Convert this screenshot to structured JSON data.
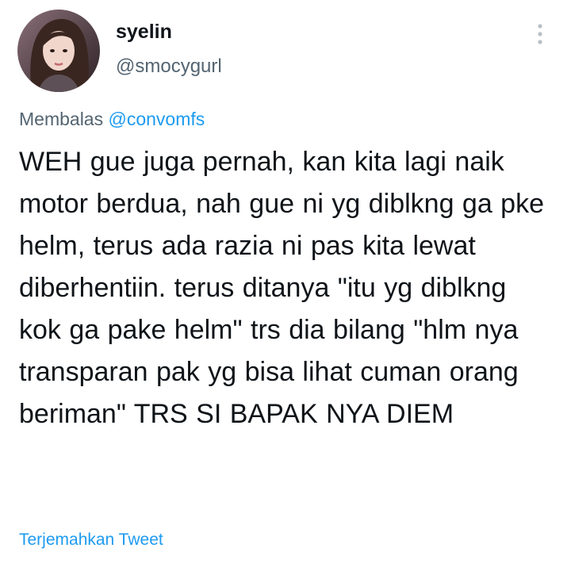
{
  "author": {
    "name": "syelin",
    "handle": "@smocygurl"
  },
  "reply_context": {
    "prefix": "Membalas",
    "mention": "@convomfs"
  },
  "tweet": {
    "text": "WEH gue juga pernah, kan kita lagi naik motor berdua, nah gue ni yg diblkng ga pke helm, terus ada razia ni pas kita lewat diberhentiin. terus ditanya \"itu yg diblkng kok ga pake helm\" trs dia bilang \"hlm nya transparan pak yg bisa lihat cuman orang beriman\" TRS SI BAPAK NYA DIEM"
  },
  "actions": {
    "translate_label": "Terjemahkan Tweet"
  },
  "icons": {
    "more": "more-vertical-icon"
  },
  "colors": {
    "text": "#0f1419",
    "secondary": "#536471",
    "link": "#1d9bf0"
  }
}
